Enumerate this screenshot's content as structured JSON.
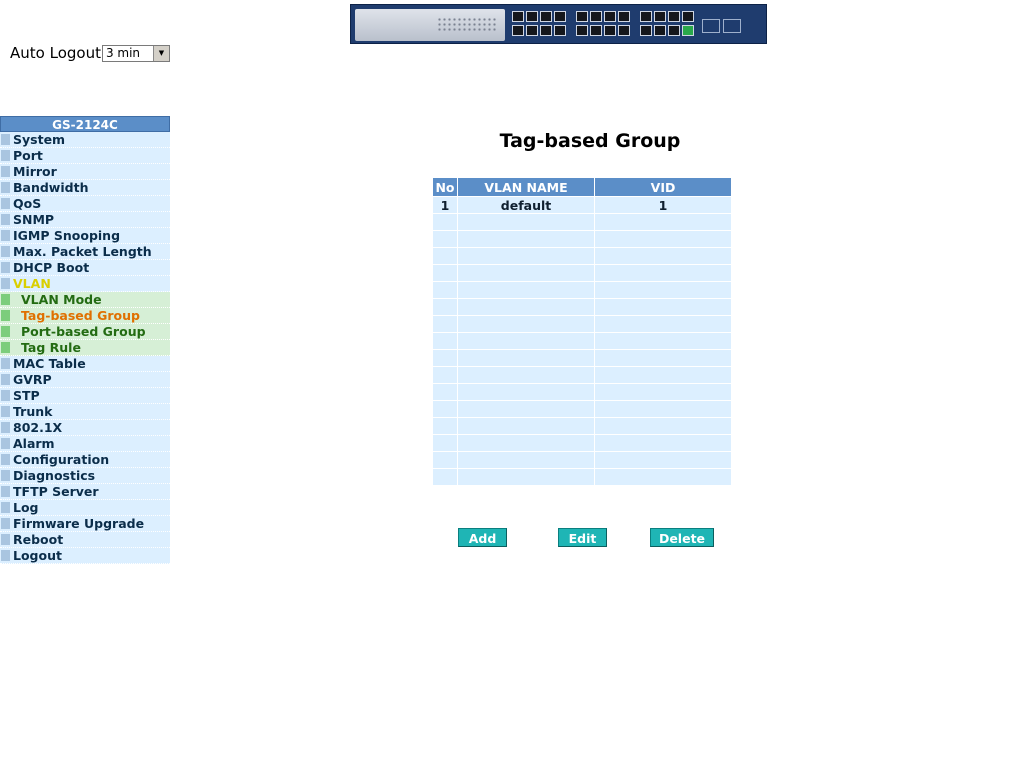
{
  "auto_logout": {
    "label": "Auto Logout",
    "selected": "3 min"
  },
  "sidebar": {
    "title": "GS-2124C",
    "items": [
      {
        "label": "System",
        "level": 0
      },
      {
        "label": "Port",
        "level": 0
      },
      {
        "label": "Mirror",
        "level": 0
      },
      {
        "label": "Bandwidth",
        "level": 0
      },
      {
        "label": "QoS",
        "level": 0
      },
      {
        "label": "SNMP",
        "level": 0
      },
      {
        "label": "IGMP Snooping",
        "level": 0
      },
      {
        "label": "Max. Packet Length",
        "level": 0
      },
      {
        "label": "DHCP Boot",
        "level": 0
      },
      {
        "label": "VLAN",
        "level": 0,
        "state": "active"
      },
      {
        "label": "VLAN Mode",
        "level": 1
      },
      {
        "label": "Tag-based Group",
        "level": 1,
        "state": "current"
      },
      {
        "label": "Port-based Group",
        "level": 1
      },
      {
        "label": "Tag Rule",
        "level": 1
      },
      {
        "label": "MAC Table",
        "level": 0
      },
      {
        "label": "GVRP",
        "level": 0
      },
      {
        "label": "STP",
        "level": 0
      },
      {
        "label": "Trunk",
        "level": 0
      },
      {
        "label": "802.1X",
        "level": 0
      },
      {
        "label": "Alarm",
        "level": 0
      },
      {
        "label": "Configuration",
        "level": 0
      },
      {
        "label": "Diagnostics",
        "level": 0
      },
      {
        "label": "TFTP Server",
        "level": 0
      },
      {
        "label": "Log",
        "level": 0
      },
      {
        "label": "Firmware Upgrade",
        "level": 0
      },
      {
        "label": "Reboot",
        "level": 0
      },
      {
        "label": "Logout",
        "level": 0
      }
    ]
  },
  "main": {
    "title": "Tag-based Group",
    "table": {
      "headers": [
        "No",
        "VLAN NAME",
        "VID"
      ],
      "rows": [
        [
          "1",
          "default",
          "1"
        ],
        [
          "",
          "",
          ""
        ],
        [
          "",
          "",
          ""
        ],
        [
          "",
          "",
          ""
        ],
        [
          "",
          "",
          ""
        ],
        [
          "",
          "",
          ""
        ],
        [
          "",
          "",
          ""
        ],
        [
          "",
          "",
          ""
        ],
        [
          "",
          "",
          ""
        ],
        [
          "",
          "",
          ""
        ],
        [
          "",
          "",
          ""
        ],
        [
          "",
          "",
          ""
        ],
        [
          "",
          "",
          ""
        ],
        [
          "",
          "",
          ""
        ],
        [
          "",
          "",
          ""
        ],
        [
          "",
          "",
          ""
        ],
        [
          "",
          "",
          ""
        ]
      ]
    },
    "buttons": {
      "add": "Add",
      "edit": "Edit",
      "delete": "Delete"
    }
  },
  "colors": {
    "header_blue": "#5b8ec8",
    "row_light_blue": "#dcefff",
    "submenu_green": "#d6efd6",
    "button_teal": "#1fb5b5",
    "active_yellow": "#d9cf00",
    "current_orange": "#e07000"
  }
}
